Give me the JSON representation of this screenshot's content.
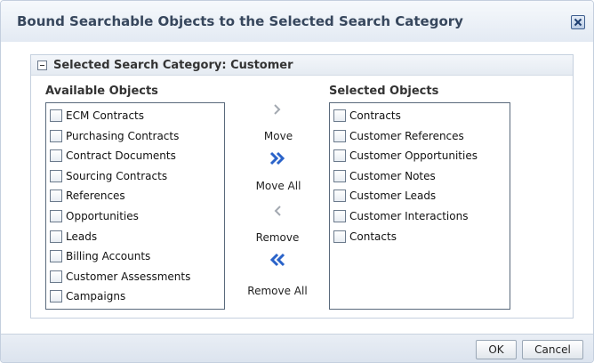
{
  "dialog": {
    "title": "Bound Searchable Objects to the Selected Search Category",
    "close_icon": "close-x-icon"
  },
  "section": {
    "title": "Selected Search Category: Customer",
    "disclosure_icon": "collapse-minus-icon"
  },
  "available": {
    "label": "Available Objects",
    "items": [
      "ECM Contracts",
      "Purchasing Contracts",
      "Contract Documents",
      "Sourcing Contracts",
      "References",
      "Opportunities",
      "Leads",
      "Billing Accounts",
      "Customer Assessments",
      "Campaigns"
    ]
  },
  "selected": {
    "label": "Selected Objects",
    "items": [
      "Contracts",
      "Customer References",
      "Customer Opportunities",
      "Customer Notes",
      "Customer Leads",
      "Customer Interactions",
      "Contacts"
    ]
  },
  "shuttle": {
    "move": "Move",
    "move_all": "Move All",
    "remove": "Remove",
    "remove_all": "Remove All",
    "move_icon": "chevron-right-icon",
    "move_all_icon": "double-chevron-right-icon",
    "remove_icon": "chevron-left-icon",
    "remove_all_icon": "double-chevron-left-icon",
    "active_color": "#2a63c9",
    "disabled_color": "#a3a9b1"
  },
  "footer": {
    "ok": "OK",
    "cancel": "Cancel"
  }
}
